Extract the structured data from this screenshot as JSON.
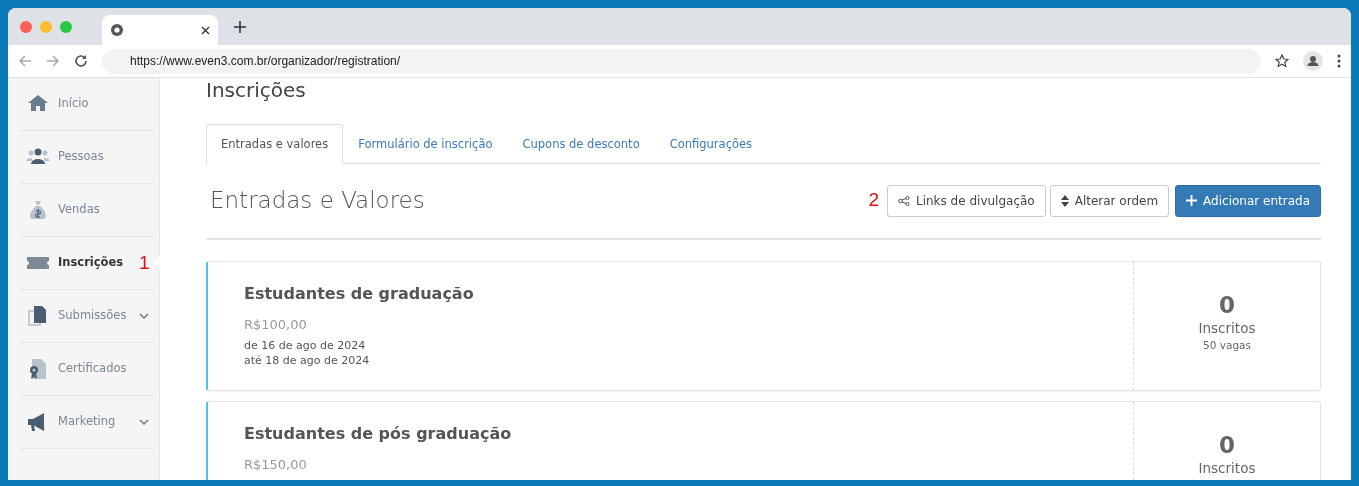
{
  "browser": {
    "tabs": [
      {
        "selected": true
      }
    ],
    "url": "https://www.even3.com.br/organizador/registration/"
  },
  "sidebar": {
    "items": [
      {
        "label": "Início",
        "selected": false,
        "expandable": false
      },
      {
        "label": "Pessoas",
        "selected": false,
        "expandable": false
      },
      {
        "label": "Vendas",
        "selected": false,
        "expandable": false
      },
      {
        "label": "Inscrições",
        "selected": true,
        "expandable": false,
        "annotation": "1"
      },
      {
        "label": "Submissões",
        "selected": false,
        "expandable": true
      },
      {
        "label": "Certificados",
        "selected": false,
        "expandable": false
      },
      {
        "label": "Marketing",
        "selected": false,
        "expandable": true
      }
    ]
  },
  "page_title": "Inscrições",
  "tabs": [
    {
      "label": "Entradas e valores",
      "selected": true
    },
    {
      "label": "Formulário de inscrição",
      "selected": false
    },
    {
      "label": "Cupons de desconto",
      "selected": false
    },
    {
      "label": "Configurações",
      "selected": false
    }
  ],
  "section_title": "Entradas e Valores",
  "toolbar": {
    "annotation": "2",
    "buttons": [
      {
        "label": "Links de divulgação",
        "kind": "share",
        "primary": false
      },
      {
        "label": "Alterar ordem",
        "kind": "sort",
        "primary": false
      },
      {
        "label": "Adicionar entrada",
        "kind": "add",
        "primary": true
      }
    ]
  },
  "tickets": [
    {
      "name": "Estudantes de graduação",
      "price": "R$100,00",
      "start": "de 16 de ago de 2024",
      "end": "até 18 de ago de 2024",
      "count": "0",
      "count_label": "Inscritos",
      "slots": "50 vagas"
    },
    {
      "name": "Estudantes de pós graduação",
      "price": "R$150,00",
      "count": "0",
      "count_label": "Inscritos"
    }
  ]
}
